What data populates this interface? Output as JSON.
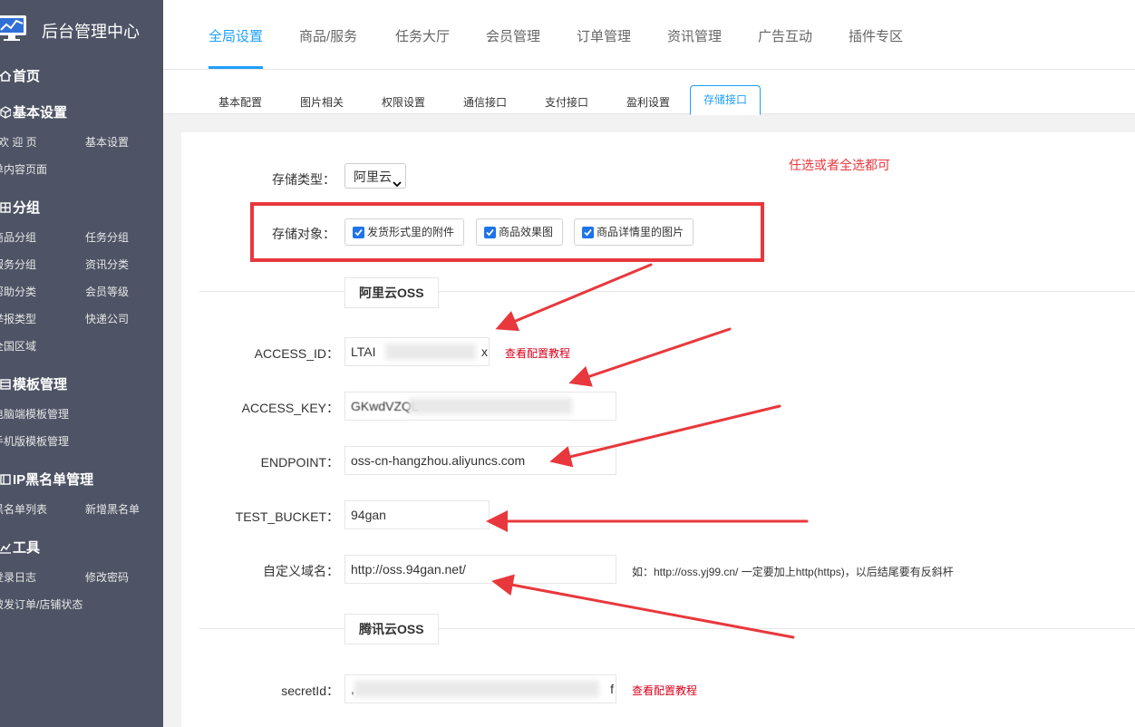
{
  "sidebar": {
    "brand_title": "后台管理中心",
    "sections": [
      {
        "title": "首页",
        "icon": "home-icon",
        "items": []
      },
      {
        "title": "基本设置",
        "icon": "cube-icon",
        "items": [
          "欢 迎 页",
          "基本设置",
          "单内容页面"
        ]
      },
      {
        "title": "分组",
        "icon": "grid-icon",
        "items": [
          "商品分组",
          "任务分组",
          "服务分组",
          "资讯分类",
          "帮助分类",
          "会员等级",
          "举报类型",
          "快递公司",
          "全国区域"
        ]
      },
      {
        "title": "模板管理",
        "icon": "template-icon",
        "items": [
          "电脑端模板管理",
          "手机版模板管理"
        ]
      },
      {
        "title": "IP黑名单管理",
        "icon": "list-icon",
        "items": [
          "黑名单列表",
          "新增黑名单"
        ]
      },
      {
        "title": "工具",
        "icon": "chart-icon",
        "items": [
          "登录日志",
          "修改密码",
          "被发订单/店铺状态"
        ]
      }
    ]
  },
  "topnav": {
    "tabs": [
      "全局设置",
      "商品/服务",
      "任务大厅",
      "会员管理",
      "订单管理",
      "资讯管理",
      "广告互动",
      "插件专区"
    ],
    "active": "全局设置"
  },
  "subtabs": {
    "tabs": [
      "基本配置",
      "图片相关",
      "权限设置",
      "通信接口",
      "支付接口",
      "盈利设置",
      "存储接口"
    ],
    "active": "存储接口"
  },
  "form": {
    "storage_type_label": "存储类型：",
    "storage_type_value": "阿里云",
    "storage_target_label": "存储对象：",
    "checkboxes": [
      {
        "label": "发货形式里的附件",
        "checked": true
      },
      {
        "label": "商品效果图",
        "checked": true
      },
      {
        "label": "商品详情里的图片",
        "checked": true
      }
    ],
    "annotation": "任选或者全选都可",
    "aliyun": {
      "legend": "阿里云OSS",
      "access_id_label": "ACCESS_ID：",
      "access_id_value": "LTAI",
      "access_id_tail": "x",
      "access_key_label": "ACCESS_KEY：",
      "access_key_value": "GKwdVZQL",
      "endpoint_label": "ENDPOINT：",
      "endpoint_value": "oss-cn-hangzhou.aliyuncs.com",
      "bucket_label": "TEST_BUCKET：",
      "bucket_value": "94gan",
      "domain_label": "自定义域名：",
      "domain_value": "http://oss.94gan.net/",
      "domain_tip": "如：http://oss.yj99.cn/ 一定要加上http(https)，以后结尾要有反斜杆",
      "tutorial_link": "查看配置教程"
    },
    "tencent": {
      "legend": "腾讯云OSS",
      "secret_id_label": "secretId：",
      "secret_id_value": ",",
      "secret_id_tail": "f",
      "tutorial_link": "查看配置教程"
    }
  },
  "colors": {
    "sidebar_bg": "#4e5465",
    "accent": "#1e9fff",
    "annotation_red": "#e8383d",
    "link_red": "#d9001b",
    "checkbox_blue": "#1e74e8"
  }
}
